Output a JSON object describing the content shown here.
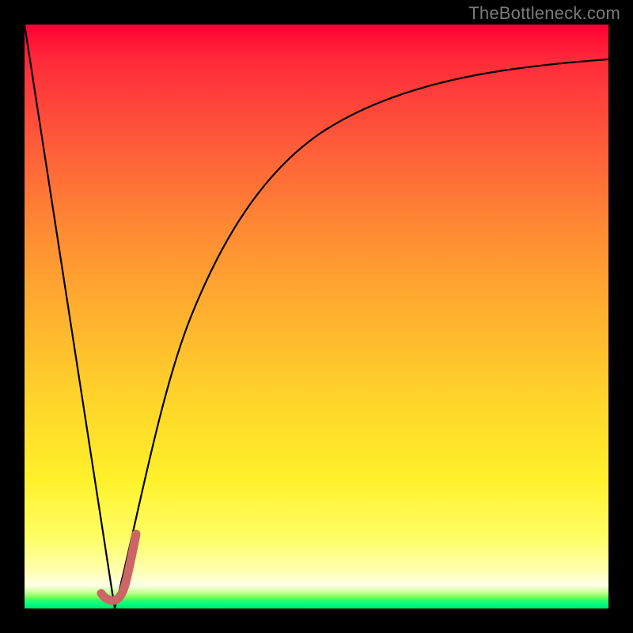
{
  "watermark": "TheBottleneck.com",
  "colors": {
    "frame": "#000000",
    "curve": "#000000",
    "highlight": "#cc6666",
    "gradient_top": "#ff0033",
    "gradient_bottom": "#00e66a"
  },
  "chart_data": {
    "type": "line",
    "title": "",
    "xlabel": "",
    "ylabel": "",
    "xlim": [
      0,
      100
    ],
    "ylim": [
      0,
      100
    ],
    "grid": false,
    "legend": false,
    "series": [
      {
        "name": "left-line",
        "x": [
          0,
          15.5
        ],
        "values": [
          100,
          0
        ]
      },
      {
        "name": "right-curve",
        "x": [
          15.5,
          17,
          20,
          24,
          28,
          33,
          38,
          45,
          53,
          62,
          72,
          83,
          92,
          100
        ],
        "values": [
          0,
          10,
          26,
          42,
          54,
          63,
          70,
          76,
          81,
          85,
          88,
          90.5,
          92,
          93
        ]
      },
      {
        "name": "highlight-hook",
        "x": [
          13.2,
          14.6,
          16.1,
          17.3,
          18.3,
          19.1
        ],
        "values": [
          2.6,
          1.6,
          1.6,
          4.5,
          8.5,
          12.8
        ]
      }
    ]
  }
}
